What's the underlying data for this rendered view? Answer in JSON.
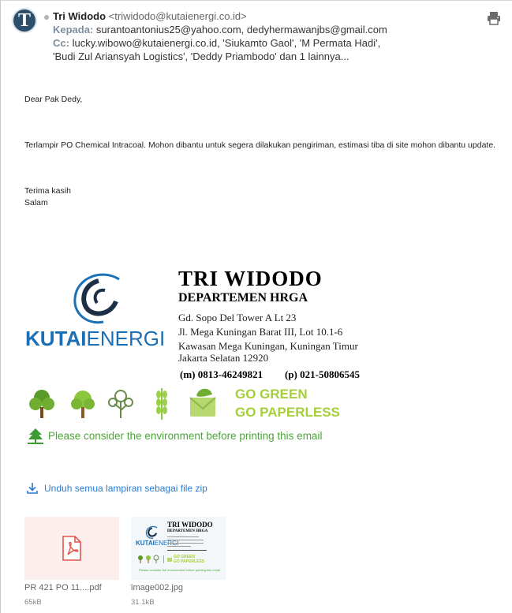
{
  "sender": {
    "avatar_letter": "T",
    "name": "Tri Widodo",
    "email": "<triwidodo@kutaienergi.co.id>"
  },
  "recipients": {
    "to_label": "Kepada:",
    "to_value": "surantoantonius25@yahoo.com,  dedyhermawanjbs@gmail.com",
    "cc_label": "Cc:",
    "cc_line1": "lucky.wibowo@kutaienergi.co.id,  'Siukamto Gaol',  'M Permata Hadi',",
    "cc_line2": "'Budi Zul Ariansyah Logistics',  'Deddy Priambodo'  dan 1 lainnya..."
  },
  "body": {
    "greeting": "Dear Pak Dedy,",
    "message": "Terlampir PO Chemical Intracoal. Mohon dibantu untuk segera dilakukan pengiriman, estimasi tiba di site mohon dibantu update.",
    "closing1": "Terima kasih",
    "closing2": "Salam"
  },
  "signature": {
    "logo_bold": "KUTAI",
    "logo_regular": "ENERGI",
    "name": "TRI WIDODO",
    "department": "DEPARTEMEN HRGA",
    "address1": "Gd. Sopo Del Tower A Lt 23",
    "address2": "Jl. Mega Kuningan Barat III, Lot 10.1-6",
    "address3": "Kawasan Mega Kuningan, Kuningan Timur",
    "address4": "Jakarta Selatan 12920",
    "mobile": "(m) 0813-46249821",
    "phone": "(p) 021-50806545",
    "go_green": "GO GREEN",
    "go_paperless": "GO PAPERLESS",
    "env_note": "Please consider the environment before printing this email"
  },
  "attachments": {
    "download_all_label": "Unduh semua lampiran sebagai file zip",
    "files": [
      {
        "name": "PR 421 PO 11....pdf",
        "size": "65kB"
      },
      {
        "name": "image002.jpg",
        "size": "31.1kB"
      }
    ]
  },
  "colors": {
    "link": "#2b7cd3",
    "green_text": "#4ca53a",
    "logo_blue": "#1a6fb5"
  }
}
